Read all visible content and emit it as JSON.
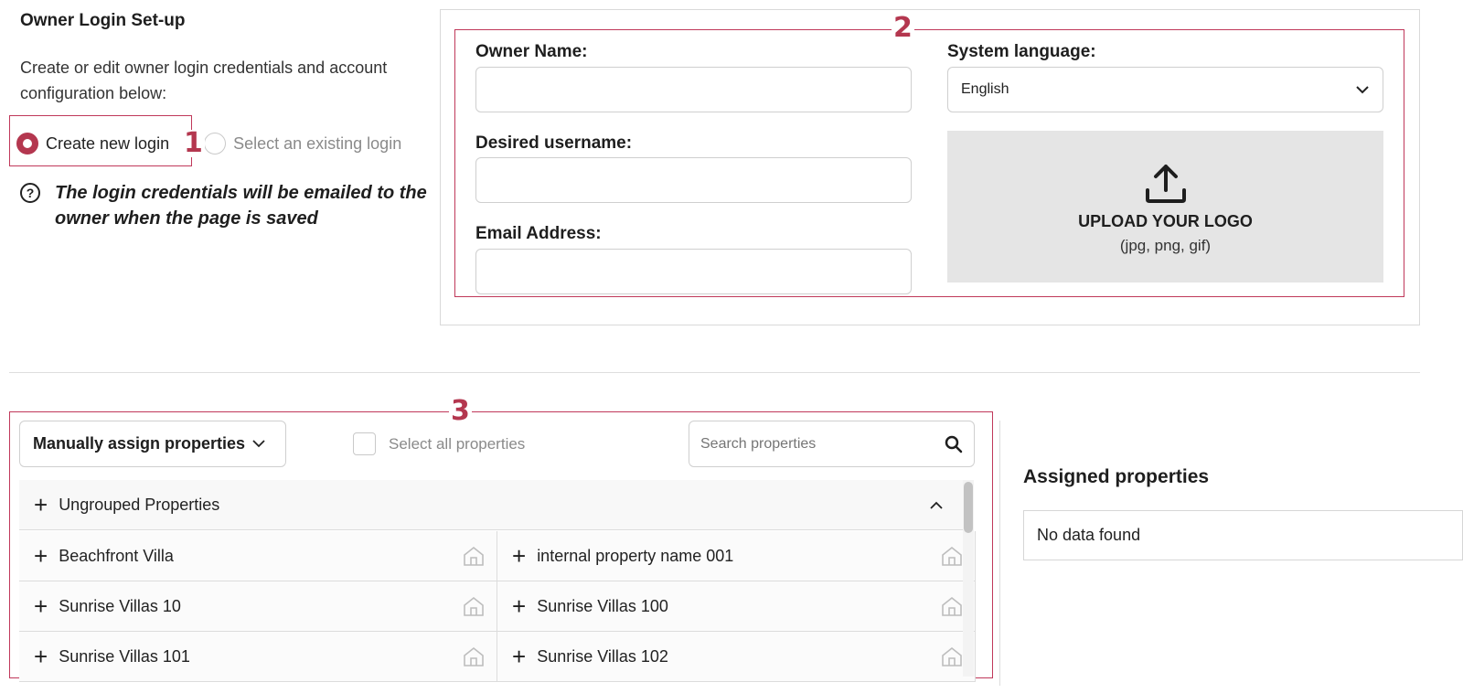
{
  "section": {
    "title": "Owner Login Set-up",
    "description": "Create or edit owner login credentials and account configuration below:"
  },
  "login_mode": {
    "options": [
      {
        "label": "Create new login",
        "selected": true
      },
      {
        "label": "Select an existing login",
        "selected": false
      }
    ]
  },
  "help": {
    "icon": "question-circle-icon",
    "text": "The login credentials will be emailed to the owner when the page is saved"
  },
  "markers": [
    "1",
    "2",
    "3"
  ],
  "form": {
    "owner_name_label": "Owner Name:",
    "owner_name_value": "",
    "username_label": "Desired username:",
    "username_value": "",
    "email_label": "Email Address:",
    "email_value": "",
    "language_label": "System language:",
    "language_value": "English",
    "upload_icon": "upload-icon",
    "upload_title": "UPLOAD YOUR LOGO",
    "upload_hint": "(jpg, png, gif)"
  },
  "properties": {
    "assign_mode": "Manually assign properties",
    "select_all_label": "Select all properties",
    "select_all_checked": false,
    "search_placeholder": "Search properties",
    "group_name": "Ungrouped Properties",
    "items": [
      {
        "name": "Beachfront Villa"
      },
      {
        "name": "internal property name 001"
      },
      {
        "name": "Sunrise Villas 10"
      },
      {
        "name": "Sunrise Villas 100"
      },
      {
        "name": "Sunrise Villas 101"
      },
      {
        "name": "Sunrise Villas 102"
      }
    ]
  },
  "assigned": {
    "title": "Assigned properties",
    "empty_text": "No data found"
  },
  "colors": {
    "accent": "#b4374f",
    "highlight_border": "#c0385a",
    "upload_bg": "#e5e5e5"
  }
}
